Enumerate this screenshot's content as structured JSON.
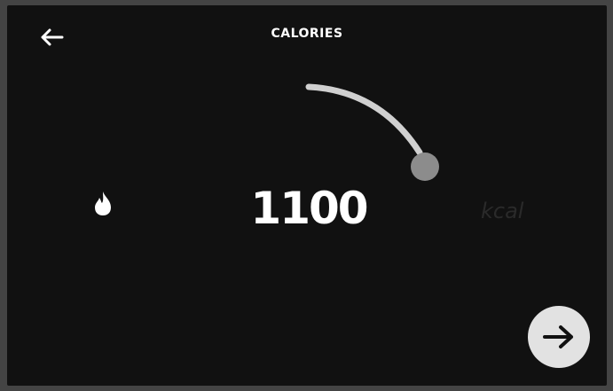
{
  "header": {
    "title": "CALORIES",
    "back_icon": "arrow-left-icon"
  },
  "calories": {
    "value": "1100",
    "unit": "kcal",
    "icon": "flame-icon"
  },
  "dial": {
    "knob_color": "#8c8c8c",
    "track_color": "#d0d0d0"
  },
  "footer": {
    "next_icon": "arrow-right-icon",
    "next_button_color": "#e2e2e2"
  },
  "colors": {
    "background": "#111111",
    "text": "#ffffff",
    "unit_text": "#2a2a2a"
  }
}
